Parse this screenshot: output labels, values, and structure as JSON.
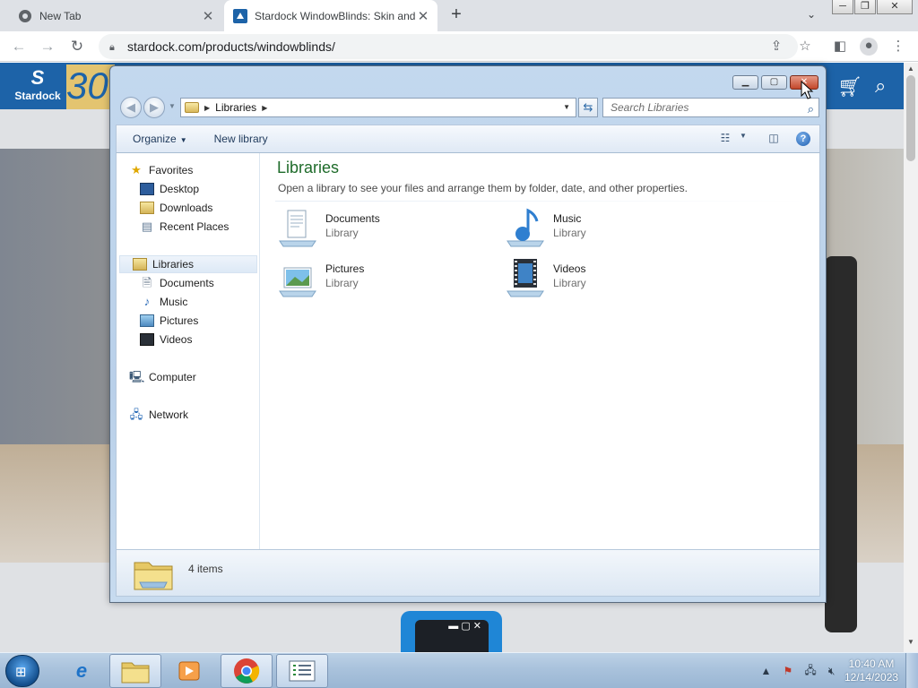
{
  "browser": {
    "tabs": [
      {
        "label": "New Tab",
        "close": "✕"
      },
      {
        "label": "Stardock WindowBlinds: Skin and Customize Windows",
        "close": "✕"
      }
    ],
    "new_tab": "+",
    "url": "stardock.com/products/windowblinds/",
    "window_controls": [
      "─",
      "❐",
      "✕"
    ]
  },
  "site": {
    "logo_text": "Stardock",
    "logo_30": "30",
    "cart_icon": "cart-icon",
    "search_icon": "search-icon"
  },
  "explorer": {
    "address": {
      "crumb": "Libraries"
    },
    "search_placeholder": "Search Libraries",
    "commands": {
      "organize": "Organize",
      "new_library": "New library"
    },
    "nav": {
      "favorites": "Favorites",
      "desktop": "Desktop",
      "downloads": "Downloads",
      "recent_places": "Recent Places",
      "libraries": "Libraries",
      "documents": "Documents",
      "music": "Music",
      "pictures": "Pictures",
      "videos": "Videos",
      "computer": "Computer",
      "network": "Network"
    },
    "content": {
      "title": "Libraries",
      "subtitle": "Open a library to see your files and arrange them by folder, date, and other properties.",
      "libraries": [
        {
          "name": "Documents",
          "type": "Library"
        },
        {
          "name": "Music",
          "type": "Library"
        },
        {
          "name": "Pictures",
          "type": "Library"
        },
        {
          "name": "Videos",
          "type": "Library"
        }
      ]
    },
    "details": {
      "count": "4 items"
    }
  },
  "taskbar": {
    "time": "10:40 AM",
    "date": "12/14/2023"
  },
  "colors": {
    "explorer_title": "#1e6b2a",
    "site_header": "#1d63a8",
    "taskbar": "#a9c2dc"
  }
}
